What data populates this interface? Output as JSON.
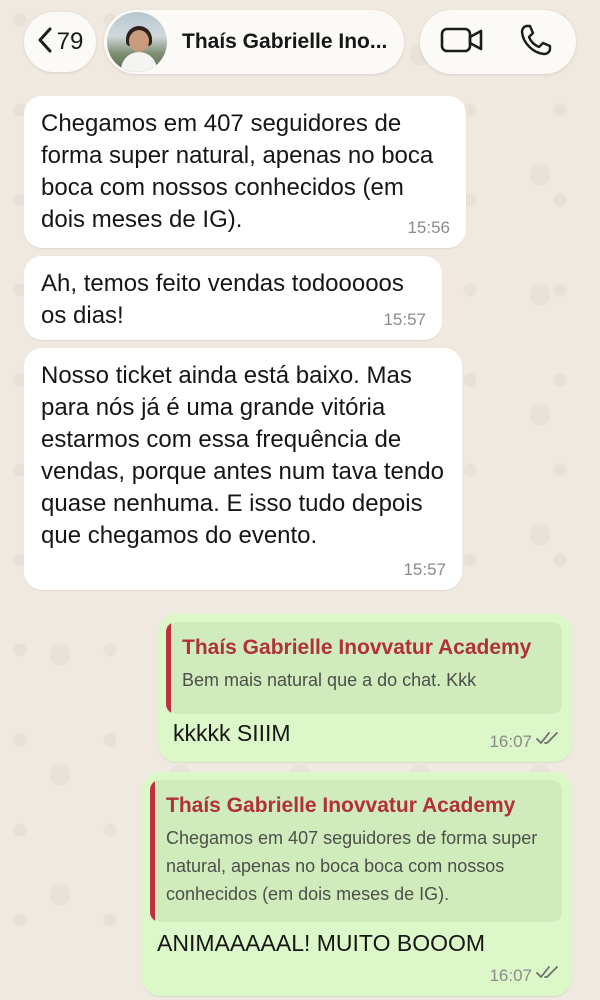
{
  "header": {
    "back_count": "79",
    "chat_title": "Thaís Gabrielle Ino..."
  },
  "messages": [
    {
      "direction": "incoming",
      "text": "Chegamos em 407 seguidores de forma super natural, apenas no boca boca com nossos conhecidos (em dois meses de IG).",
      "time": "15:56"
    },
    {
      "direction": "incoming",
      "text": "Ah, temos feito vendas todooooos os dias!",
      "time": "15:57"
    },
    {
      "direction": "incoming",
      "text": "Nosso ticket ainda está baixo. Mas para nós já é uma grande vitória estarmos com essa frequência de vendas, porque antes num tava tendo quase nenhuma. E isso tudo depois que chegamos do evento.",
      "time": "15:57"
    },
    {
      "direction": "outgoing",
      "quote_author": "Thaís Gabrielle Inovvatur Academy",
      "quote_text": "Bem mais natural que a do chat. Kkk",
      "text": "kkkkk SIIIM",
      "time": "16:07",
      "status": "read"
    },
    {
      "direction": "outgoing",
      "quote_author": "Thaís Gabrielle Inovvatur Academy",
      "quote_text": "Chegamos em 407 seguidores de forma super natural, apenas no boca boca com nossos conhecidos (em dois meses de IG).",
      "text": "ANIMAAAAAL! MUITO BOOOM",
      "time": "16:07",
      "status": "read"
    }
  ],
  "icons": {
    "back": "chevron-left-icon",
    "video": "video-camera-icon",
    "call": "phone-icon",
    "read_receipt": "double-check-icon"
  },
  "colors": {
    "incoming_bubble": "#ffffff",
    "outgoing_bubble": "#dcf8c8",
    "quote_accent": "#c0313e",
    "wallpaper": "#efe9e0"
  }
}
